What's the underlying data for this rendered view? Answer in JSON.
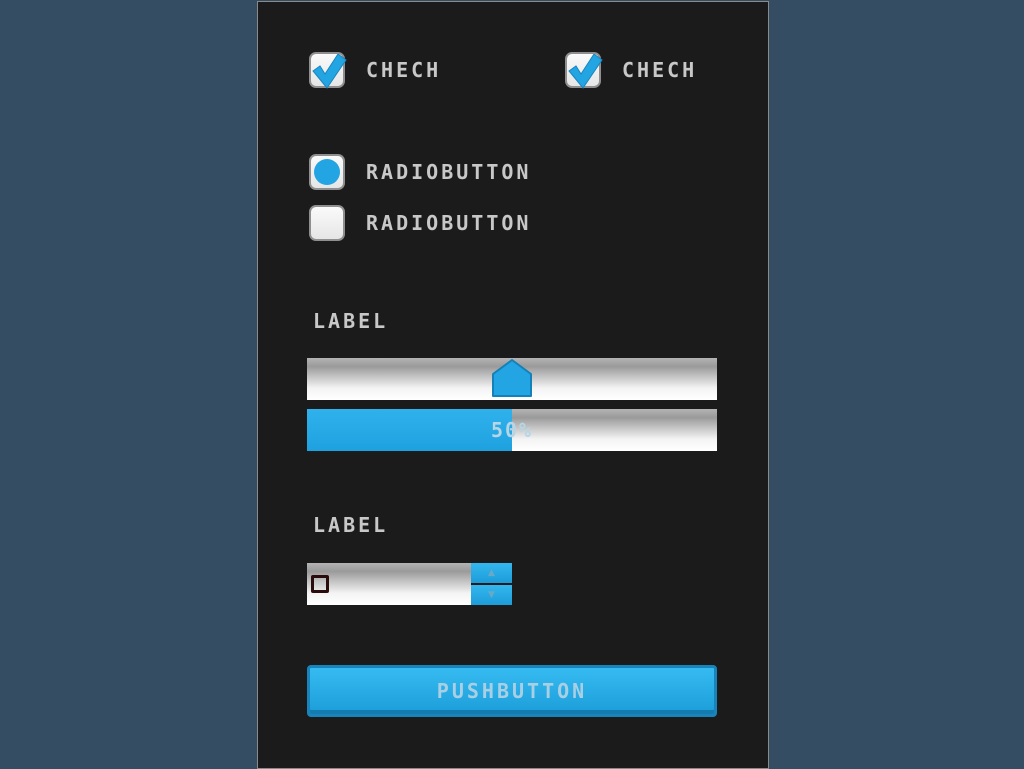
{
  "checkboxes": [
    {
      "label": "CHECH",
      "checked": true
    },
    {
      "label": "CHECH",
      "checked": true
    }
  ],
  "radios": [
    {
      "label": "RADIOBUTTON",
      "selected": true
    },
    {
      "label": "RADIOBUTTON",
      "selected": false
    }
  ],
  "slider": {
    "label": "LABEL",
    "value": 0.5
  },
  "progress": {
    "value": 0.5,
    "text": "50%"
  },
  "spinbox": {
    "label": "LABEL",
    "value": "0",
    "up_icon": "triangle-up-icon",
    "down_icon": "triangle-down-icon"
  },
  "push_button": {
    "label": "PUSHBUTTON"
  },
  "colors": {
    "background": "#344d63",
    "panel": "#1b1b1b",
    "accent": "#22a5e2",
    "text": "#c8c8c8"
  }
}
